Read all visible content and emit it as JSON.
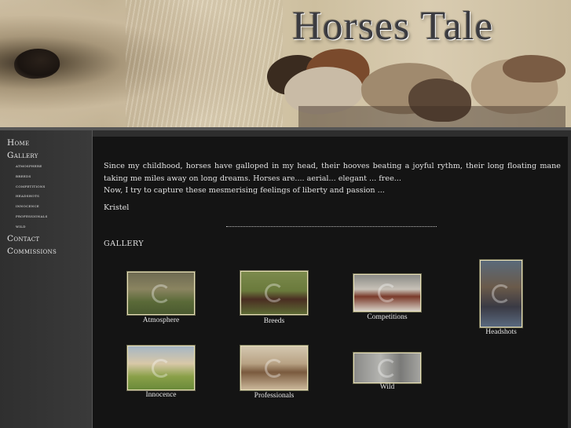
{
  "site": {
    "title_first": "Horses",
    "title_second": "Tale"
  },
  "sidebar": {
    "items": [
      {
        "label": "Home",
        "level": "main"
      },
      {
        "label": "Gallery",
        "level": "main"
      },
      {
        "label": "atmosphere",
        "level": "sub"
      },
      {
        "label": "breeds",
        "level": "sub"
      },
      {
        "label": "competitions",
        "level": "sub"
      },
      {
        "label": "headshots",
        "level": "sub"
      },
      {
        "label": "innocence",
        "level": "sub"
      },
      {
        "label": "professionals",
        "level": "sub"
      },
      {
        "label": "wild",
        "level": "sub"
      },
      {
        "label": "Contact",
        "level": "main"
      },
      {
        "label": "Commissions",
        "level": "main"
      }
    ]
  },
  "main": {
    "intro_line1": "Since my childhood, horses have galloped in my head, their hooves beating a joyful rythm, their long floating mane taking me miles away on long dreams. Horses are.... aerial... elegant ... free...",
    "intro_line2": "Now, I try to capture these mesmerising feelings of liberty and passion ...",
    "signature": "Kristel",
    "gallery_heading": "GALLERY",
    "gallery": [
      {
        "caption": "Atmosphere"
      },
      {
        "caption": "Breeds"
      },
      {
        "caption": "Competitions"
      },
      {
        "caption": "Headshots"
      },
      {
        "caption": "Innocence"
      },
      {
        "caption": "Professionals"
      },
      {
        "caption": "Wild"
      }
    ]
  },
  "colors": {
    "accent_border": "#e8e0b8",
    "background": "#141414",
    "sidebar": "#3a3a3a"
  }
}
